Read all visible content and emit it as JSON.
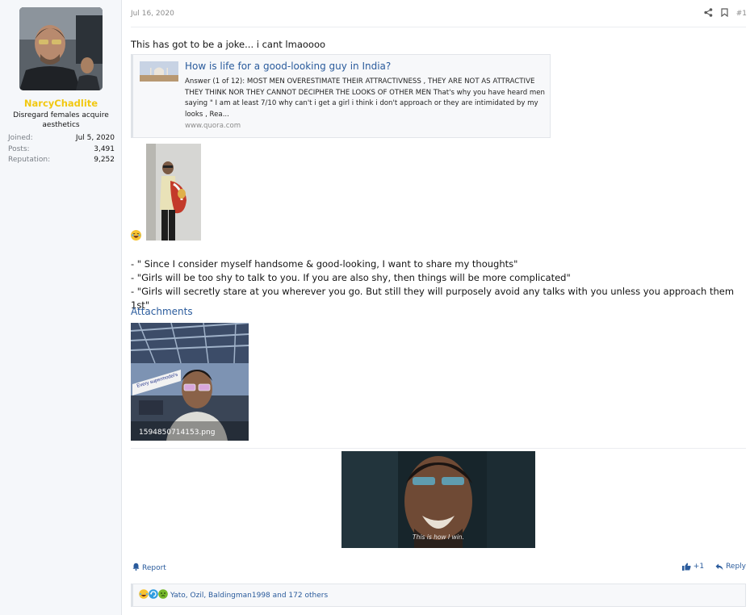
{
  "user": {
    "name": "NarcyChadlite",
    "title": "Disregard females acquire aesthetics",
    "stats": [
      {
        "label": "Joined:",
        "value": "Jul 5, 2020"
      },
      {
        "label": "Posts:",
        "value": "3,491"
      },
      {
        "label": "Reputation:",
        "value": "9,252"
      }
    ]
  },
  "post": {
    "date": "Jul 16, 2020",
    "number": "#1",
    "intro": "This has got to be a joke... i cant lmaoooo",
    "unfurl": {
      "title": "How is life for a good-looking guy in India?",
      "description": "Answer (1 of 12): MOST MEN OVERESTIMATE THEIR ATTRACTIVNESS , THEY ARE NOT AS ATTRACTIVE THEY THINK NOR THEY CANNOT DECIPHER THE LOOKS OF OTHER MEN That's why you have heard men saying \" I am at least 7/10 why can't i get a girl i think i don't approach or they are intimidated by my looks , Rea...",
      "host": "www.quora.com"
    },
    "quotes": [
      "- \" Since I consider myself handsome & good-looking, I want to share my thoughts\"",
      "- \"Girls will be too shy to talk to you. If you are also shy, then things will be more complicated\"",
      "- \"Girls will secretly stare at you wherever you go. But still they will purposely avoid any talks with you unless you approach them 1st\""
    ],
    "attachments_heading": "Attachments",
    "attachment_filename": "1594850714153.png",
    "attachment_sign_text": "Every supermodel's",
    "gif_caption": "This is how I win."
  },
  "footer": {
    "report_label": "Report",
    "like_label": "+1",
    "reply_label": "Reply"
  },
  "reactions": {
    "text": "Yato, Ozil, Baldingman1998 and 172 others"
  },
  "colors": {
    "username": "#f2c811",
    "link": "#2a5b9c"
  }
}
